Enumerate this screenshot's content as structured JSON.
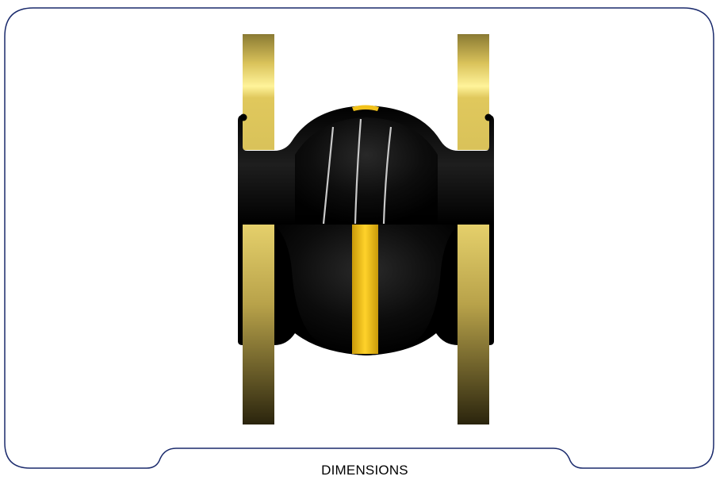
{
  "tab": {
    "label": "DIMENSIONS"
  },
  "colors": {
    "frame": "#1a2a6c",
    "rubber": "#050505",
    "flange_gold": "#d9c25a",
    "stripe_yellow": "#f2c21b",
    "wire": "#c9c9c9"
  },
  "illustration": {
    "subject": "rubber-expansion-joint",
    "view": "half-section"
  }
}
